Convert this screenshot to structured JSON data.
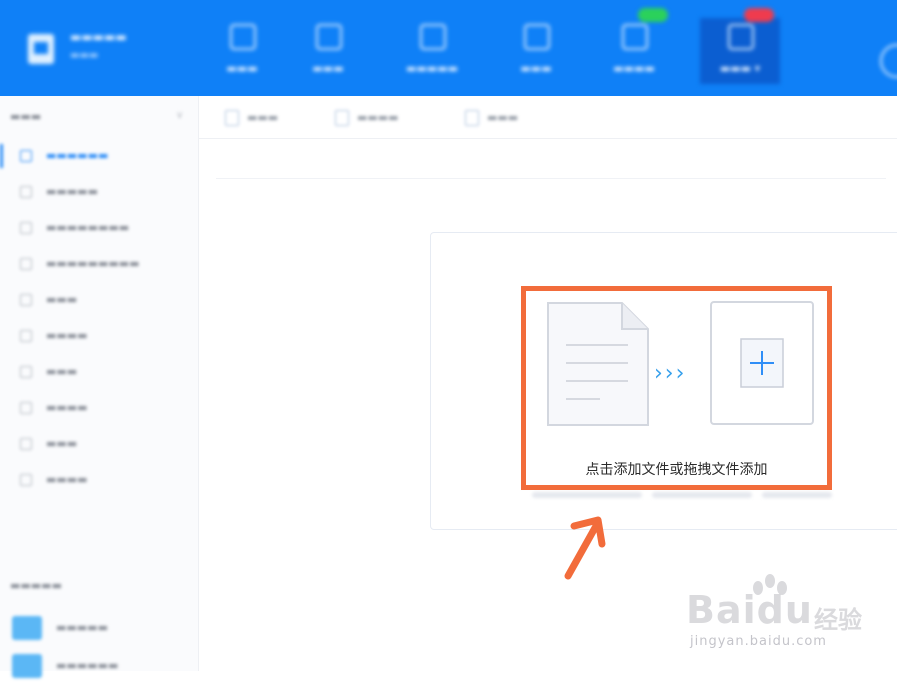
{
  "colors": {
    "topbar": "#0f80f7",
    "accent": "#2f8ef7",
    "highlight": "#f26c3b",
    "arrow": "#38a1ec"
  },
  "icons": {
    "document": "document-icon",
    "add": "plus-square-icon",
    "chevrons": "triple-chevron-right-icon",
    "pointer": "arrow-pointer-icon"
  },
  "drop_zone": {
    "chevrons": "›››",
    "add_text": "点击添加文件或拖拽文件添加"
  },
  "watermark": {
    "brand": "Bai",
    "brand2": "du",
    "brand_cn": "经验",
    "url": "jingyan.baidu.com"
  }
}
